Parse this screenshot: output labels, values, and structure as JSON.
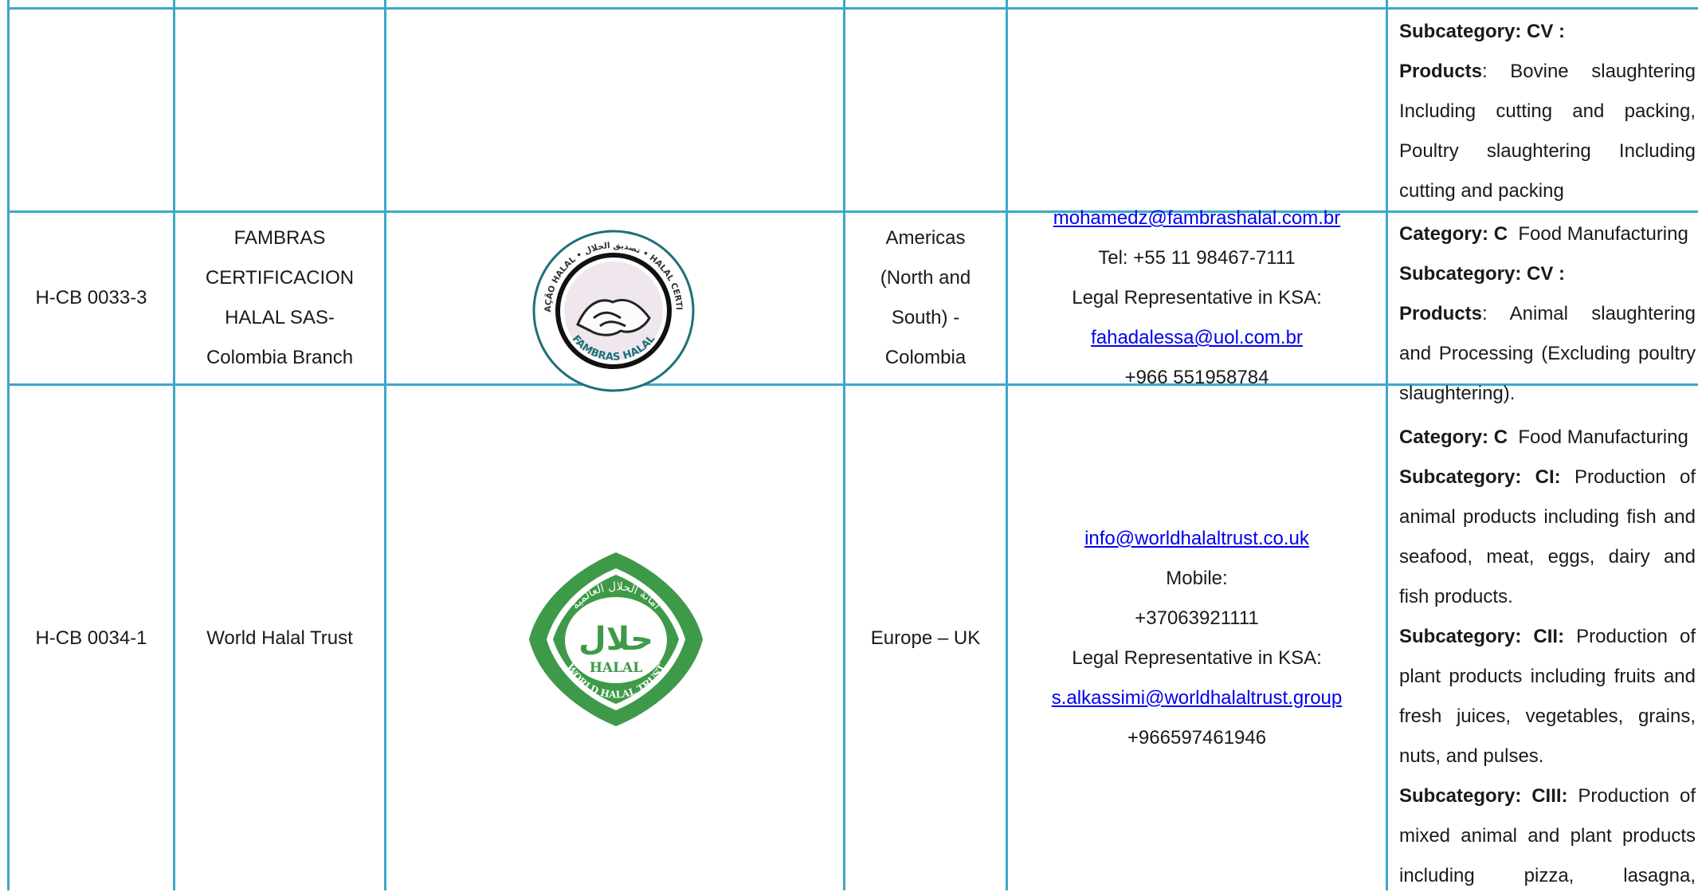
{
  "colors": {
    "border": "#3ea7c8",
    "link": "#0000ee",
    "logo_green": "#3e9a48",
    "logo_teal": "#1f6f7a"
  },
  "row0": {
    "sub_label": "Subcategory: CV :",
    "prod_label": "Products",
    "prod_lines": [
      "Bovine slaughtering",
      "Including cutting and packing,",
      "Poultry slaughtering Including"
    ],
    "prod_last": "cutting and packing"
  },
  "row1": {
    "id": "H-CB 0033-3",
    "name_lines": [
      "FAMBRAS",
      "CERTIFICACION",
      "HALAL SAS-",
      "Colombia Branch"
    ],
    "logo": {
      "icon": "handshake-seal-icon",
      "ring_top": "CERTIFICAÇÃO HALAL • تصديق الحلال • HALAL CERTIFICATION",
      "ring_bottom": "FAMBRAS HALAL"
    },
    "region_lines": [
      "Americas",
      "(North and",
      "South) -",
      "Colombia"
    ],
    "contact": {
      "email": "mohamedz@fambrashalal.com.br",
      "tel": "Tel: +55 11 98467-7111",
      "rep_label": "Legal Representative in KSA:",
      "rep_email": "fahadalessa@uol.com.br",
      "rep_phone": "+966 551958784"
    },
    "cat_label": "Category: C",
    "cat_text": "Food Manufacturing",
    "sub_label": "Subcategory: CV :",
    "prod_label": "Products",
    "prod_lines": [
      "Animal slaughtering",
      "and Processing (Excluding poultry"
    ],
    "prod_last": "slaughtering)."
  },
  "row2": {
    "id": "H-CB 0034-1",
    "name": "World Halal Trust",
    "logo": {
      "icon": "world-halal-trust-icon",
      "arabic_arc": "أمانة الحلال العالمية",
      "arabic_center": "حلال",
      "latin_word": "HALAL",
      "arc_text": "WORLD HALAL TRUST"
    },
    "region": "Europe – UK",
    "contact": {
      "email": "info@worldhalaltrust.co.uk",
      "mobile_label": "Mobile:",
      "mobile": "+37063921111",
      "rep_label": "Legal Representative in KSA:",
      "rep_email": "s.alkassimi@worldhalaltrust.group",
      "rep_phone": "+966597461946"
    },
    "cat_label": "Category: C",
    "cat_text": "Food Manufacturing",
    "ci_label": "Subcategory: CI:",
    "ci_lines": [
      "Production of",
      "animal products including fish and",
      "seafood, meat, eggs, dairy and"
    ],
    "ci_last": "fish products.",
    "cii_label": "Subcategory: CII:",
    "cii_lines": [
      "Production of",
      "plant products including fruits and",
      "fresh juices, vegetables, grains,"
    ],
    "cii_last": "nuts, and pulses.",
    "ciii_label": "Subcategory: CIII:",
    "ciii_lines": [
      "Production of",
      "mixed animal and plant products",
      "including pizza, lasagna,"
    ]
  }
}
